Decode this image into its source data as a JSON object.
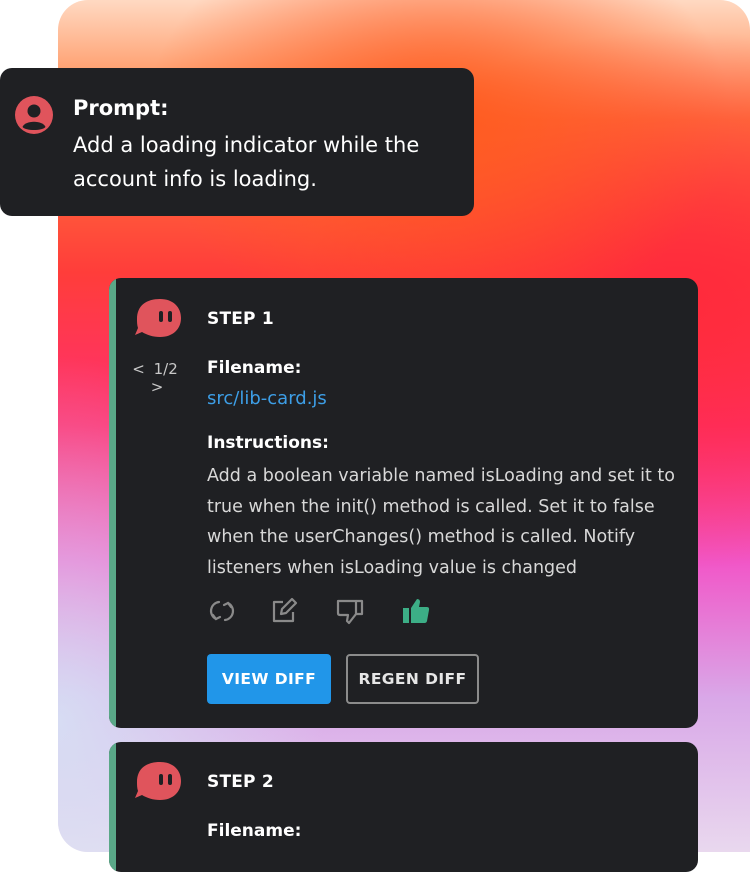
{
  "prompt": {
    "title": "Prompt:",
    "text": "Add a loading indicator while the account info is loading.",
    "icon": "user-circle-icon"
  },
  "steps": [
    {
      "title": "STEP 1",
      "pager": {
        "current": "1/2",
        "prev": "<",
        "next": ">"
      },
      "filename_label": "Filename:",
      "filename": "src/lib-card.js",
      "instructions_label": "Instructions:",
      "instructions": "Add a boolean variable named isLoading and set it to true when the init() method is called. Set it to false when the userChanges() method is called. Notify listeners when isLoading value is changed",
      "actions": [
        "regenerate-icon",
        "edit-icon",
        "thumbs-down-icon",
        "thumbs-up-icon"
      ],
      "view_diff": "VIEW DIFF",
      "regen_diff": "REGEN DIFF"
    },
    {
      "title": "STEP 2",
      "filename_label": "Filename:"
    }
  ],
  "colors": {
    "accent": "#5aa888",
    "link": "#3d9ee6",
    "primary_button": "#2196e9",
    "mascot": "#e0545c",
    "card": "#1f2023"
  }
}
